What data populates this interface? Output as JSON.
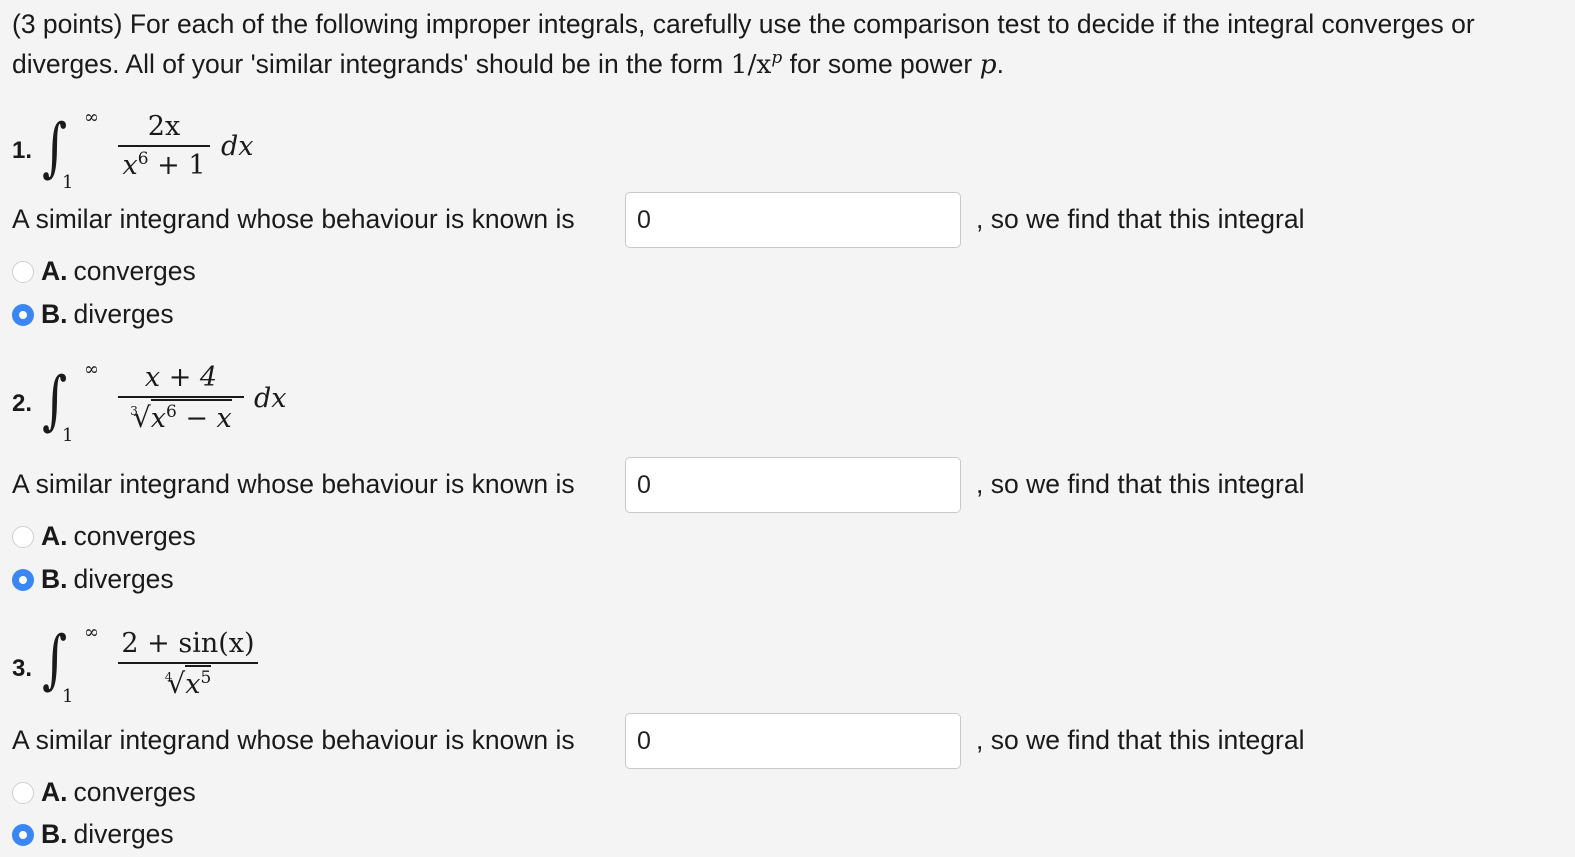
{
  "intro": {
    "prefix": "(3 points) For each of the following improper integrals, carefully use the comparison test to decide if the integral converges or diverges. All of your 'similar integrands' should be in the form ",
    "form": "1/x",
    "power_sym": "p",
    "middle": " for some power ",
    "p": "p",
    "suffix": "."
  },
  "common": {
    "lower_limit": "1",
    "upper_limit": "∞",
    "dx": "dx",
    "similar_prompt": "A similar integrand whose behaviour is known is",
    "after_text": ", so we find that this integral",
    "option_a_letter": "A.",
    "option_a_text": "converges",
    "option_b_letter": "B.",
    "option_b_text": "diverges"
  },
  "problems": [
    {
      "number": "1.",
      "numerator": "2x",
      "denominator": "x",
      "den_exp": "6",
      "den_rest": " + 1",
      "answer_value": "0",
      "selected": "B"
    },
    {
      "number": "2.",
      "numerator": "x + 4",
      "root_index": "3",
      "radicand": "x",
      "radicand_exp": "6",
      "radicand_rest": " − x",
      "answer_value": "0",
      "selected": "B"
    },
    {
      "number": "3.",
      "numerator": "2 + sin(x)",
      "root_index": "4",
      "radicand": "x",
      "radicand_exp": "5",
      "answer_value": "0",
      "selected": "B"
    }
  ],
  "colors": {
    "background": "#f4f4f4",
    "radio_selected": "#3a86f5",
    "input_border": "#c9c9c9"
  }
}
